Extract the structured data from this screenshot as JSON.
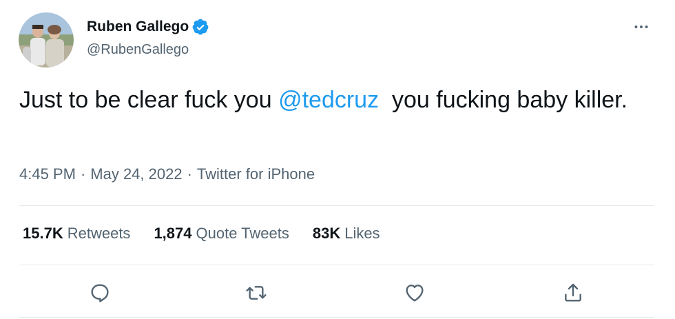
{
  "author": {
    "display_name": "Ruben Gallego",
    "handle": "@RubenGallego",
    "verified": true,
    "verified_color": "#1d9bf0"
  },
  "tweet": {
    "text_before": "Just to be clear fuck you ",
    "mention": "@tedcruz",
    "text_after": "  you fucking baby killer.",
    "mention_color": "#1d9bf0"
  },
  "meta": {
    "time": "4:45 PM",
    "separator": "·",
    "date": "May 24, 2022",
    "source": "Twitter for iPhone"
  },
  "stats": {
    "retweets_count": "15.7K",
    "retweets_label": "Retweets",
    "quotes_count": "1,874",
    "quotes_label": "Quote Tweets",
    "likes_count": "83K",
    "likes_label": "Likes"
  },
  "icons": {
    "more": "more-horizontal-icon",
    "reply": "reply-icon",
    "retweet": "retweet-icon",
    "like": "heart-icon",
    "share": "share-icon"
  }
}
